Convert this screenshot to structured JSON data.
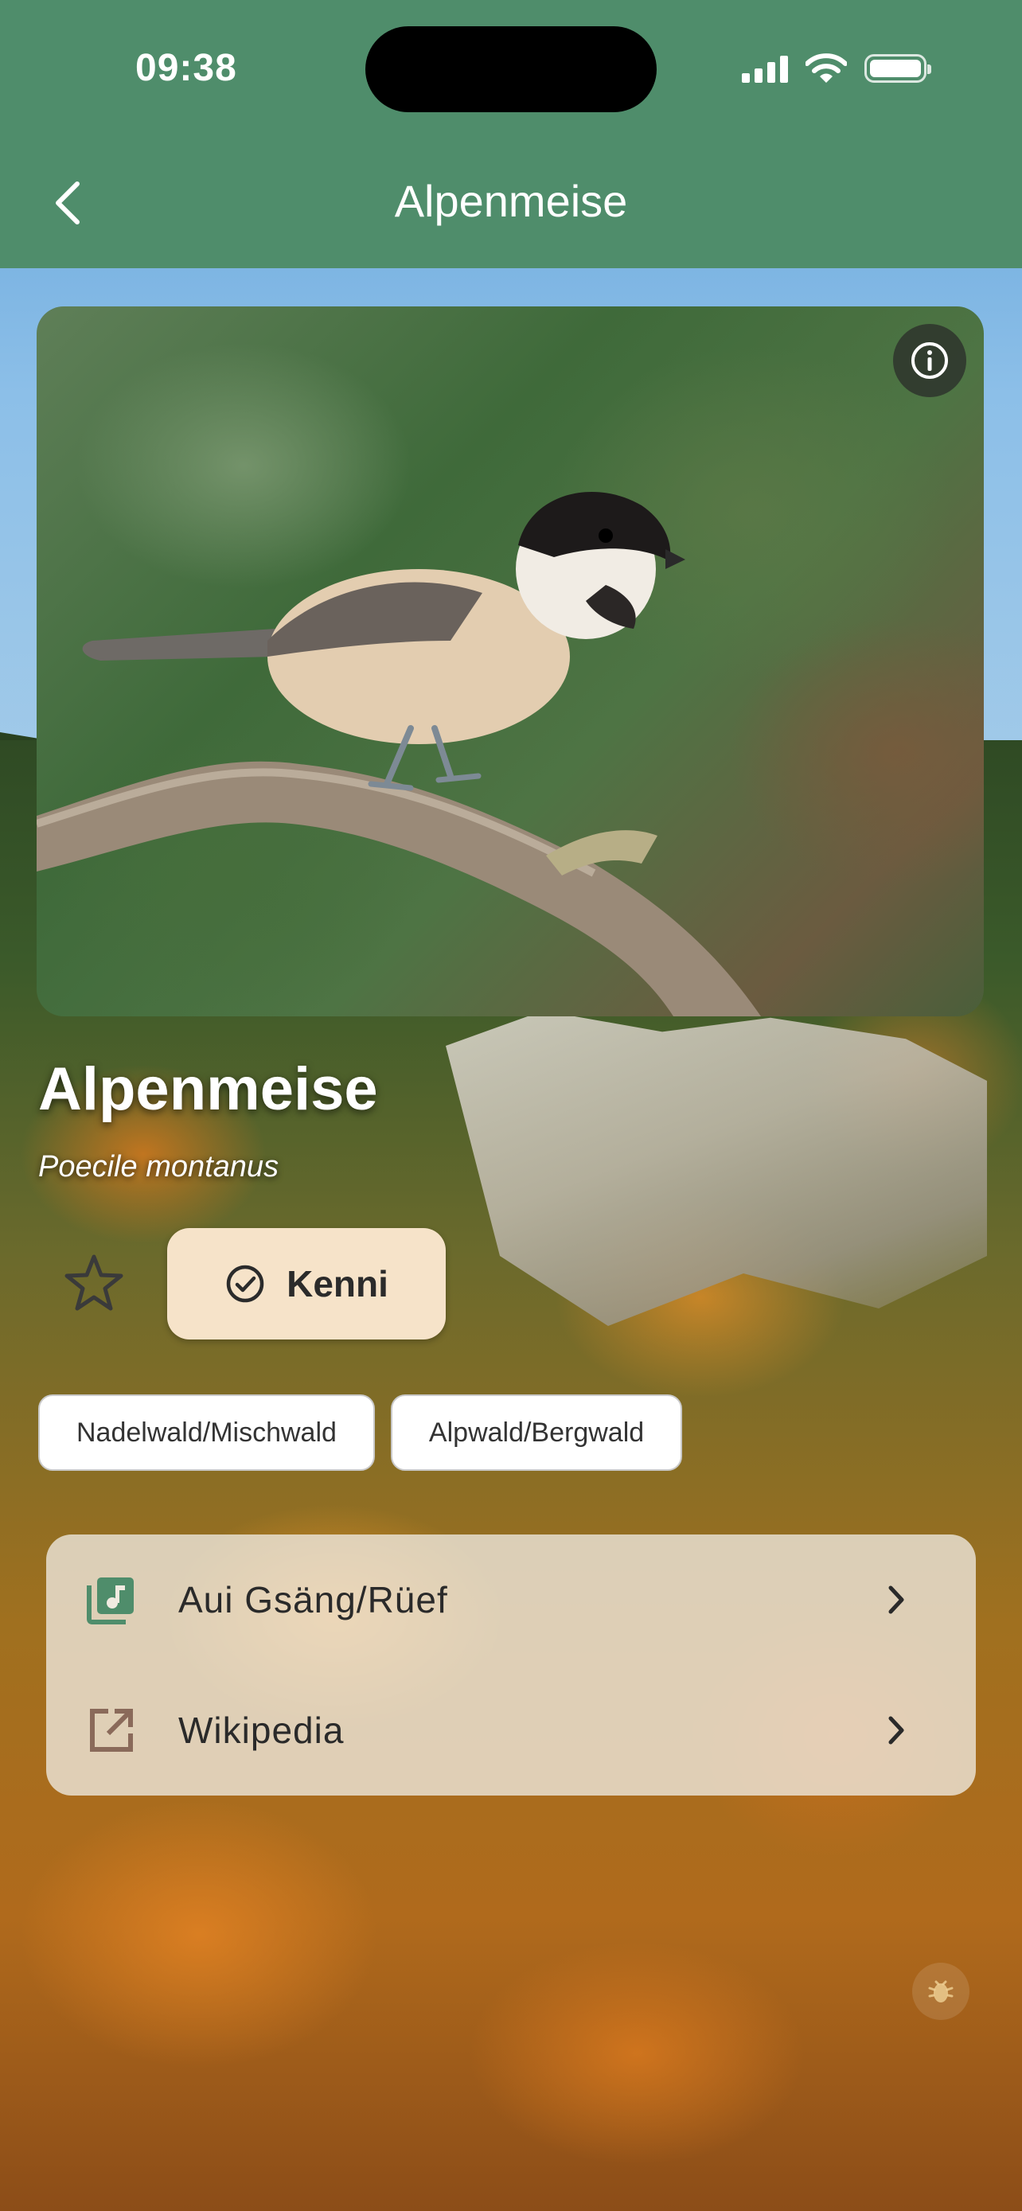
{
  "status_bar": {
    "time": "09:38",
    "icons": [
      "signal-icon",
      "wifi-icon",
      "battery-icon"
    ]
  },
  "nav": {
    "title": "Alpenmeise",
    "back_icon": "chevron-left-icon"
  },
  "photo": {
    "info_icon": "info-icon"
  },
  "species": {
    "name": "Alpenmeise",
    "latin": "Poecile montanus"
  },
  "actions": {
    "favorite_icon": "star-outline-icon",
    "kenni_label": "Kenni",
    "kenni_icon": "check-circle-icon"
  },
  "habitats": [
    "Nadelwald/Mischwald",
    "Alpwald/Bergwald"
  ],
  "links": [
    {
      "label": "Aui Gsäng/Rüef",
      "icon": "music-library-icon"
    },
    {
      "label": "Wikipedia",
      "icon": "external-link-icon"
    }
  ],
  "colors": {
    "header": "#4f8d6b",
    "kenni_button": "#f6e3c9",
    "music_icon": "#4f8d6b",
    "link_icon": "#8a6a5a"
  }
}
